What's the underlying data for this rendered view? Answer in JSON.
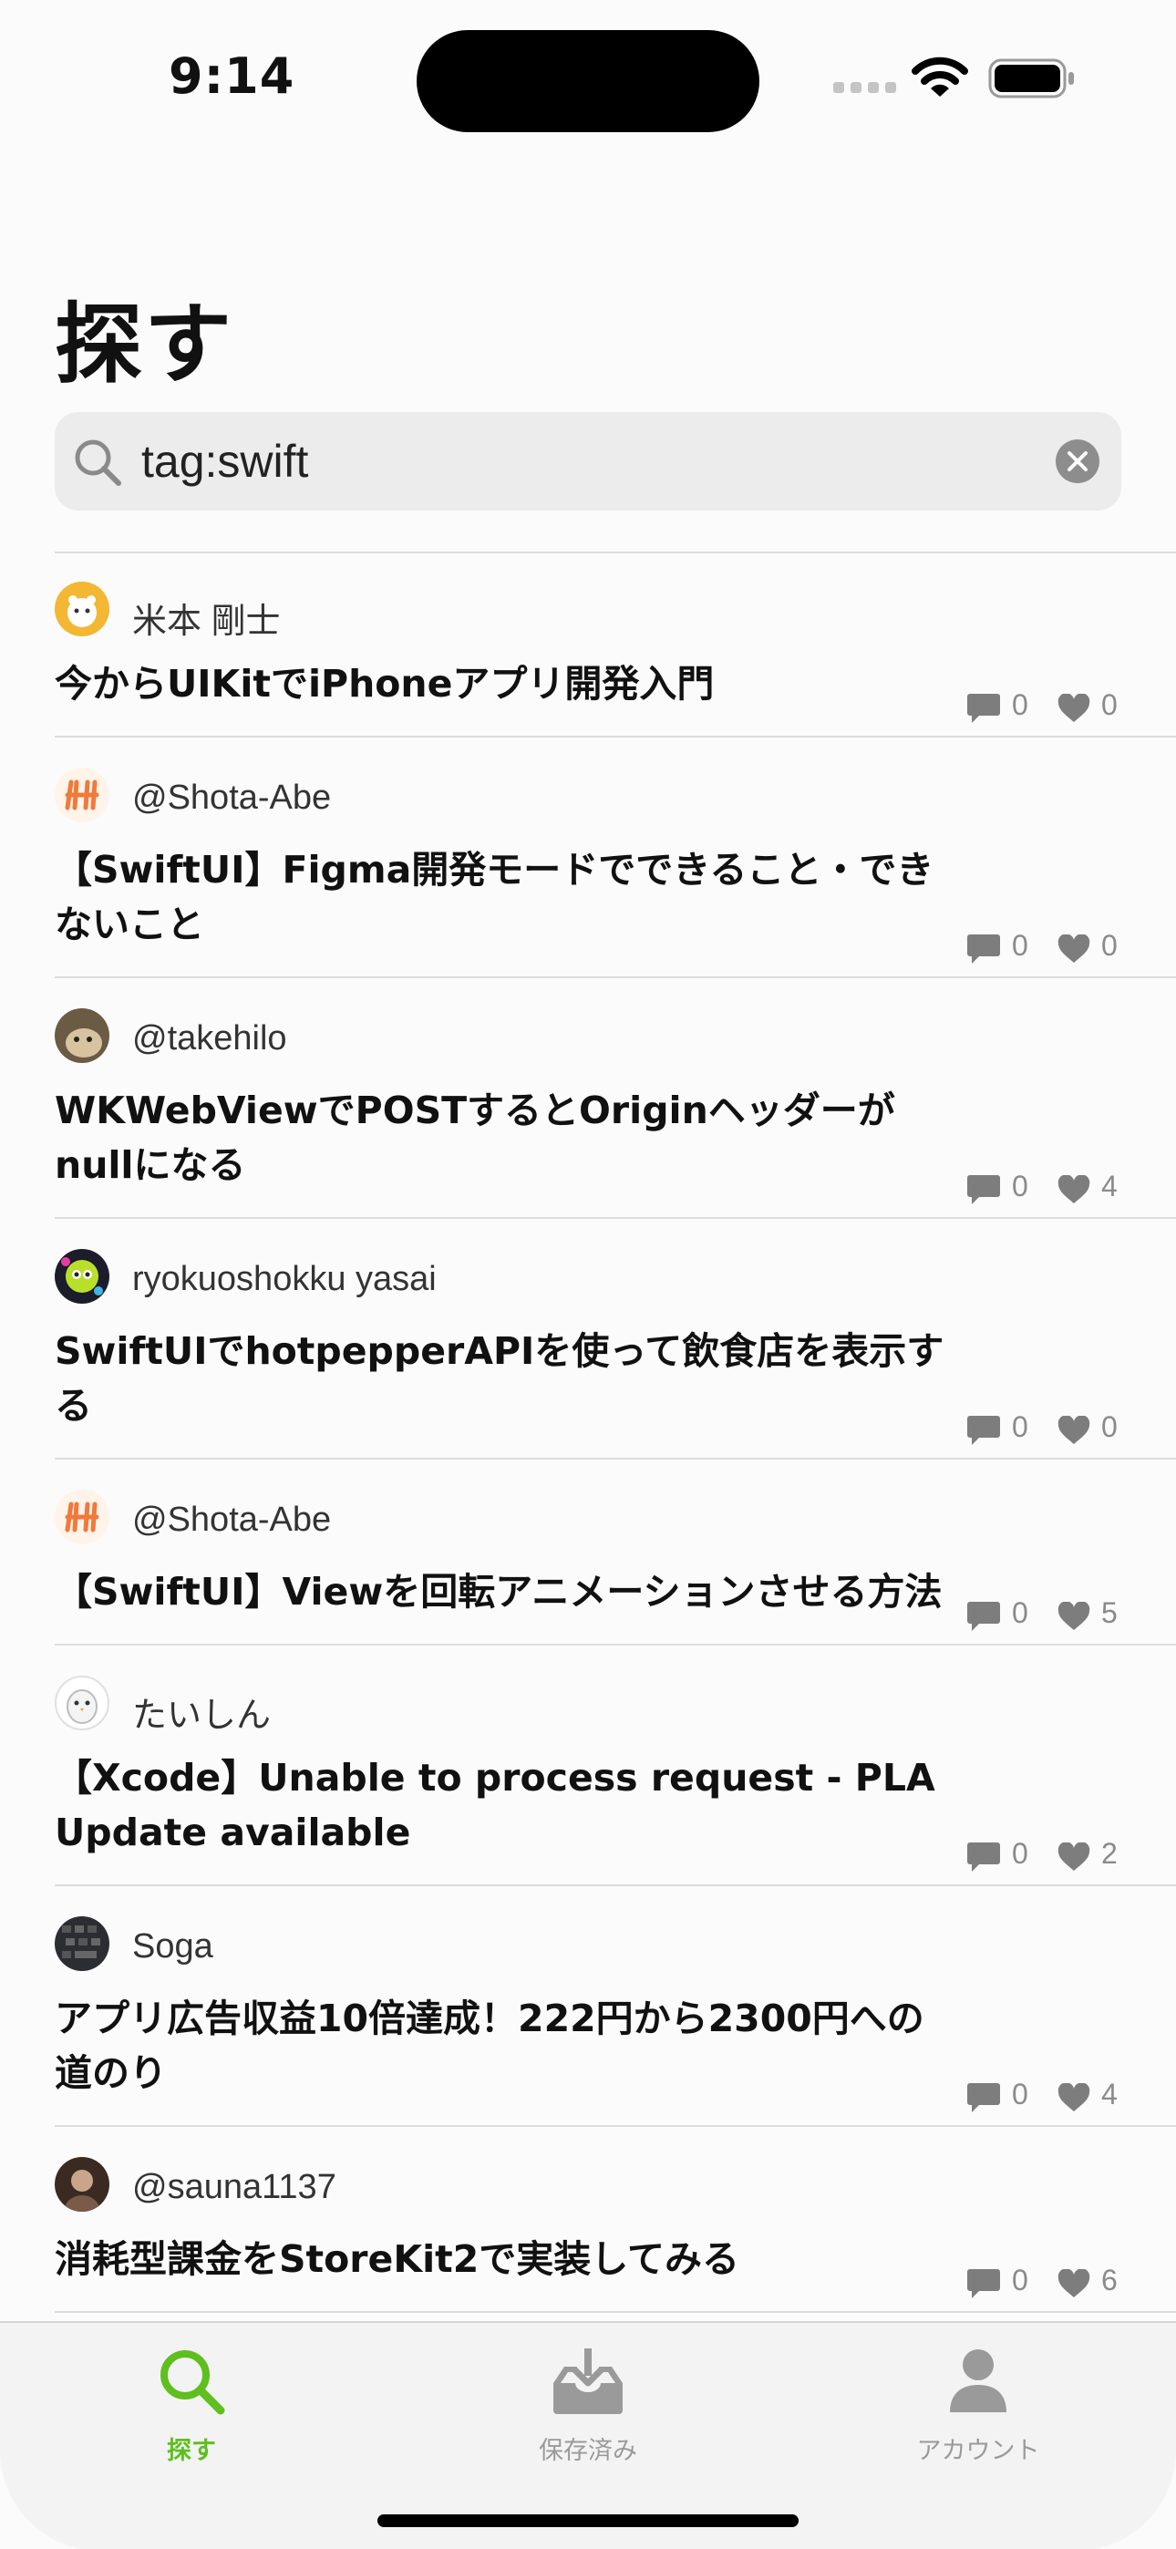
{
  "status_bar": {
    "time": "9:14"
  },
  "page": {
    "title": "探す"
  },
  "search": {
    "value": "tag:swift",
    "placeholder": ""
  },
  "colors": {
    "accent": "#5ebf1e",
    "inactive": "#9a9a9a"
  },
  "articles": [
    {
      "author": "米本 剛士",
      "title": "今からUIKitでiPhoneアプリ開発入門",
      "comments": "0",
      "likes": "0"
    },
    {
      "author": "@Shota-Abe",
      "title": "【SwiftUI】Figma開発モードでできること・できないこと",
      "comments": "0",
      "likes": "0"
    },
    {
      "author": "@takehilo",
      "title": "WKWebViewでPOSTするとOriginヘッダーがnullになる",
      "comments": "0",
      "likes": "4"
    },
    {
      "author": "ryokuoshokku yasai",
      "title": "SwiftUIでhotpepperAPIを使って飲食店を表示する",
      "comments": "0",
      "likes": "0"
    },
    {
      "author": "@Shota-Abe",
      "title": "【SwiftUI】Viewを回転アニメーションさせる方法",
      "comments": "0",
      "likes": "5"
    },
    {
      "author": "たいしん",
      "title": "【Xcode】Unable to process request - PLA Update available",
      "comments": "0",
      "likes": "2"
    },
    {
      "author": "Soga",
      "title": "アプリ広告収益10倍達成！222円から2300円への道のり",
      "comments": "0",
      "likes": "4"
    },
    {
      "author": "@sauna1137",
      "title": "消耗型課金をStoreKit2で実装してみる",
      "comments": "0",
      "likes": "6"
    }
  ],
  "tab_bar": {
    "tabs": [
      {
        "label": "探す",
        "icon": "search-icon",
        "active": true
      },
      {
        "label": "保存済み",
        "icon": "tray-download-icon",
        "active": false
      },
      {
        "label": "アカウント",
        "icon": "person-icon",
        "active": false
      }
    ]
  }
}
